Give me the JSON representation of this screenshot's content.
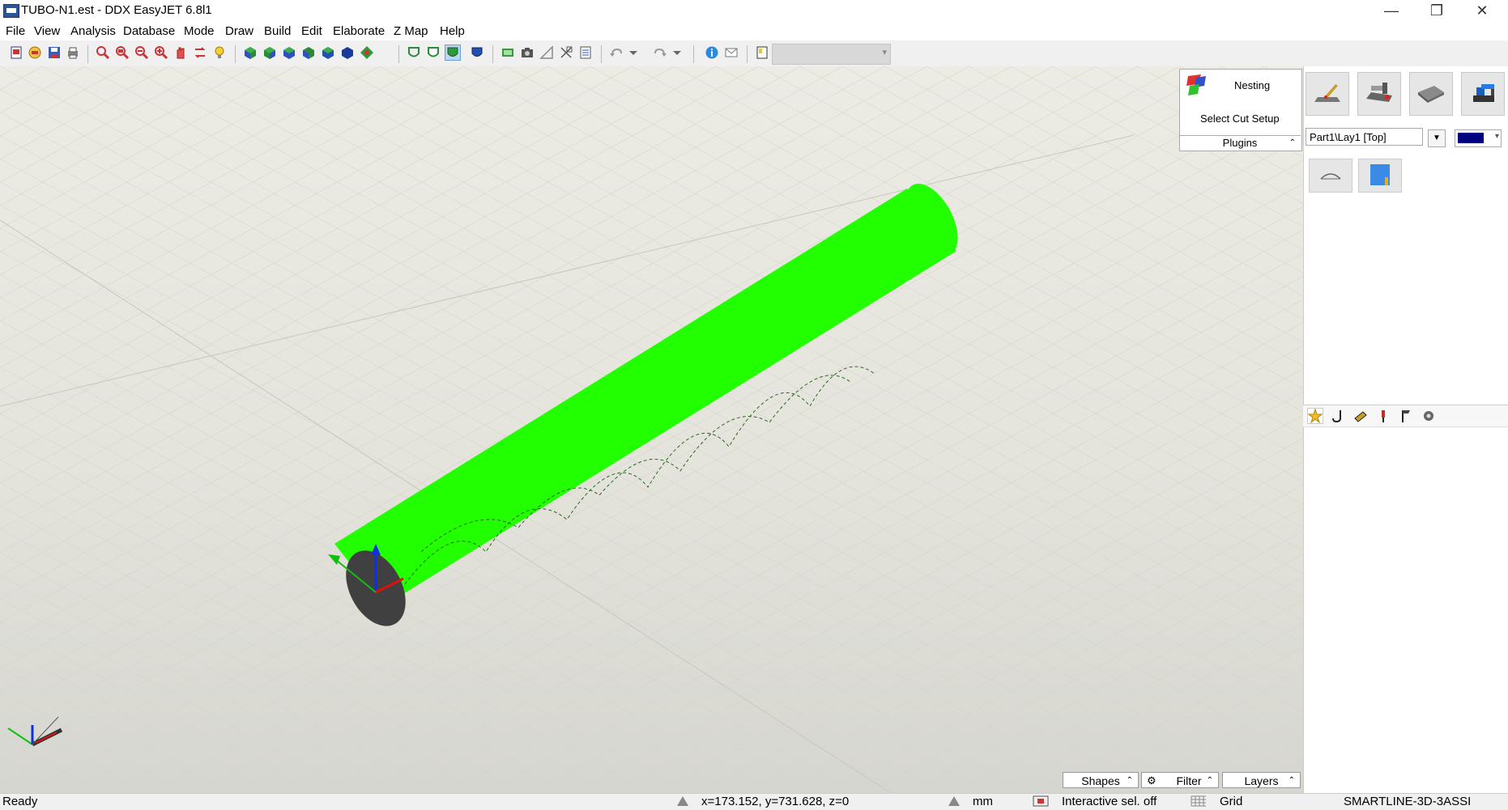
{
  "window": {
    "title": "TUBO-N1.est - DDX EasyJET 6.8l1",
    "controls": {
      "minimize": "—",
      "restore": "❐",
      "close": "✕"
    }
  },
  "menu": [
    "File",
    "View",
    "Analysis",
    "Database",
    "Mode",
    "Draw",
    "Build",
    "Edit",
    "Elaborate",
    "Z Map",
    "Help"
  ],
  "toolbar": {
    "combo_value": "",
    "icons": [
      "new-icon",
      "open-icon",
      "save-icon",
      "print-icon",
      "zoom-window-icon",
      "zoom-extents-icon",
      "zoom-out-icon",
      "zoom-in-icon",
      "pan-icon",
      "redraw-icon",
      "light-icon",
      "view-front-icon",
      "view-back-icon",
      "view-left-icon",
      "view-right-icon",
      "view-top-icon",
      "view-bottom-icon",
      "view-iso-icon",
      "wireframe-icon",
      "hidden-line-icon",
      "shaded-icon",
      "shaded-edges-icon",
      "image-icon",
      "camera-icon",
      "measure-icon",
      "select-icon",
      "report-icon",
      "undo-icon",
      "undo-dropdown-icon",
      "redo-icon",
      "redo-dropdown-icon",
      "info-icon",
      "mail-icon",
      "help-icon"
    ]
  },
  "right_panel": {
    "nesting_label": "Nesting",
    "cut_setup_label": "Select Cut Setup",
    "plugins_label": "Plugins",
    "layer_value": "Part1\\Lay1 [Top]",
    "layer_color": "#000080",
    "tool_buttons": [
      "cutting-head-icon",
      "machine-icon",
      "sheet-icon",
      "robot-icon"
    ],
    "small_buttons": [
      "arc-tool-icon",
      "blue-sheet-icon"
    ],
    "tabs": [
      "favorites-icon",
      "hook-icon",
      "pipe-icon",
      "pin-icon",
      "flag-icon",
      "gear-cloud-icon"
    ]
  },
  "viewport": {
    "tube_color": "#22ff00",
    "tube_end_color": "#404040",
    "axis_colors": {
      "x": "#e01010",
      "y": "#10c010",
      "z": "#1030e0"
    }
  },
  "panel_buttons": {
    "shapes": "Shapes",
    "filter": "Filter",
    "layers": "Layers"
  },
  "status": {
    "state": "Ready",
    "coords": "x=173.152, y=731.628, z=0",
    "units": "mm",
    "selection": "Interactive sel. off",
    "grid": "Grid",
    "machine": "SMARTLINE-3D-3ASSI"
  }
}
